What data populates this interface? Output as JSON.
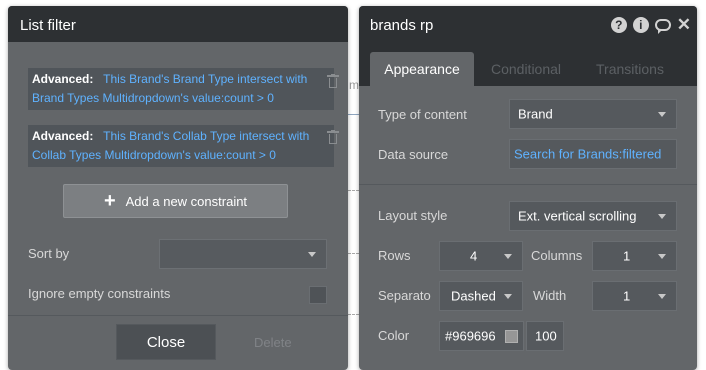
{
  "background": {
    "fragment": "m"
  },
  "list_filter": {
    "title": "List filter",
    "constraints": [
      {
        "prefix": "Advanced:",
        "expression": "This Brand's Brand Type intersect with Brand Types Multidropdown's value:count > 0"
      },
      {
        "prefix": "Advanced:",
        "expression": "This Brand's Collab Type intersect with Collab Types Multidropdown's value:count > 0"
      }
    ],
    "add_constraint_label": "Add a new constraint",
    "sort_by_label": "Sort by",
    "sort_by_value": "",
    "ignore_empty_label": "Ignore empty constraints",
    "close_label": "Close",
    "delete_label": "Delete"
  },
  "property_editor": {
    "title": "brands rp",
    "header_icons": [
      "help-icon",
      "info-icon",
      "comment-icon",
      "close-icon"
    ],
    "tabs": [
      {
        "label": "Appearance",
        "active": true
      },
      {
        "label": "Conditional",
        "active": false
      },
      {
        "label": "Transitions",
        "active": false
      }
    ],
    "type_of_content_label": "Type of content",
    "type_of_content_value": "Brand",
    "data_source_label": "Data source",
    "data_source_value": "Search for Brands:filtered",
    "layout_style_label": "Layout style",
    "layout_style_value": "Ext. vertical scrolling",
    "rows_label": "Rows",
    "rows_value": "4",
    "columns_label": "Columns",
    "columns_value": "1",
    "separator_label": "Separato",
    "separator_value": "Dashed",
    "width_label": "Width",
    "width_value": "1",
    "color_label": "Color",
    "color_value": "#969696",
    "opacity_value": "100"
  },
  "colors": {
    "panel_bg": "#636669",
    "header_bg": "#2d3033",
    "link_blue": "#5fb2ff",
    "swatch": "#969696"
  }
}
